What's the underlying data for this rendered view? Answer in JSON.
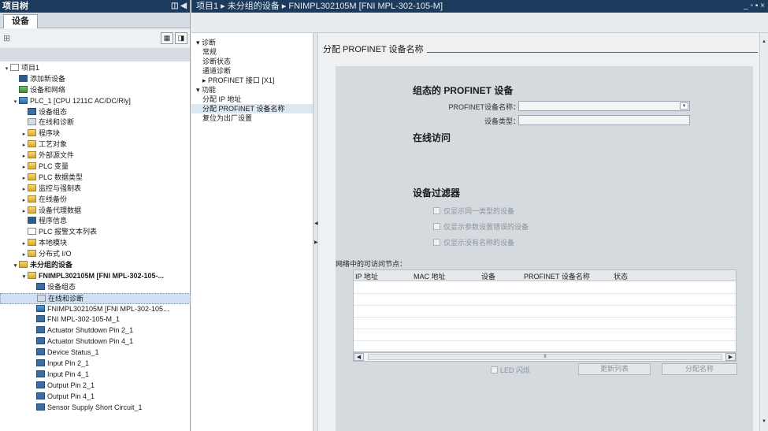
{
  "left": {
    "title": "项目树",
    "title_ctl": "◫ ◀",
    "tab": "设备",
    "toolbar_icon": "⊞",
    "tree": [
      {
        "label": "项目1",
        "level": 0,
        "arrow": "▾",
        "icon": "doc"
      },
      {
        "label": "添加新设备",
        "level": 1,
        "arrow": "",
        "icon": "blue"
      },
      {
        "label": "设备和网络",
        "level": 1,
        "arrow": "",
        "icon": "green"
      },
      {
        "label": "PLC_1 [CPU 1211C AC/DC/Rly]",
        "level": 1,
        "arrow": "▾",
        "icon": "plc"
      },
      {
        "label": "设备组态",
        "level": 2,
        "arrow": "",
        "icon": "chip"
      },
      {
        "label": "在线和诊断",
        "level": 2,
        "arrow": "",
        "icon": "gray"
      },
      {
        "label": "程序块",
        "level": 2,
        "arrow": "▸",
        "icon": "folder"
      },
      {
        "label": "工艺对象",
        "level": 2,
        "arrow": "▸",
        "icon": "folder"
      },
      {
        "label": "外部源文件",
        "level": 2,
        "arrow": "▸",
        "icon": "folder"
      },
      {
        "label": "PLC 变量",
        "level": 2,
        "arrow": "▸",
        "icon": "folder"
      },
      {
        "label": "PLC 数据类型",
        "level": 2,
        "arrow": "▸",
        "icon": "folder"
      },
      {
        "label": "监控与强制表",
        "level": 2,
        "arrow": "▸",
        "icon": "folder"
      },
      {
        "label": "在线备份",
        "level": 2,
        "arrow": "▸",
        "icon": "folder"
      },
      {
        "label": "设备代理数据",
        "level": 2,
        "arrow": "▸",
        "icon": "folder"
      },
      {
        "label": "程序信息",
        "level": 2,
        "arrow": "",
        "icon": "blue"
      },
      {
        "label": "PLC 报警文本列表",
        "level": 2,
        "arrow": "",
        "icon": "doc"
      },
      {
        "label": "本地模块",
        "level": 2,
        "arrow": "▸",
        "icon": "folder"
      },
      {
        "label": "分布式 I/O",
        "level": 2,
        "arrow": "▸",
        "icon": "folder"
      },
      {
        "label": "未分组的设备",
        "level": 1,
        "arrow": "▾",
        "icon": "folder",
        "bold": true
      },
      {
        "label": "FNIMPL302105M [FNI MPL-302-105-...",
        "level": 2,
        "arrow": "▾",
        "icon": "folder",
        "bold": true
      },
      {
        "label": "设备组态",
        "level": 3,
        "arrow": "",
        "icon": "chip"
      },
      {
        "label": "在线和诊断",
        "level": 3,
        "arrow": "",
        "icon": "gray",
        "selected": true
      },
      {
        "label": "FNIMPL302105M [FNI MPL-302-105...",
        "level": 3,
        "arrow": "",
        "icon": "plc"
      },
      {
        "label": "FNI MPL-302-105-M_1",
        "level": 3,
        "arrow": "",
        "icon": "chip"
      },
      {
        "label": "Actuator Shutdown Pin 2_1",
        "level": 3,
        "arrow": "",
        "icon": "chip"
      },
      {
        "label": "Actuator Shutdown Pin 4_1",
        "level": 3,
        "arrow": "",
        "icon": "chip"
      },
      {
        "label": "Device Status_1",
        "level": 3,
        "arrow": "",
        "icon": "chip"
      },
      {
        "label": "Input Pin 2_1",
        "level": 3,
        "arrow": "",
        "icon": "chip"
      },
      {
        "label": "Input Pin 4_1",
        "level": 3,
        "arrow": "",
        "icon": "chip"
      },
      {
        "label": "Output Pin 2_1",
        "level": 3,
        "arrow": "",
        "icon": "chip"
      },
      {
        "label": "Output Pin 4_1",
        "level": 3,
        "arrow": "",
        "icon": "chip"
      },
      {
        "label": "Sensor Supply Short Circuit_1",
        "level": 3,
        "arrow": "",
        "icon": "chip"
      }
    ]
  },
  "header": {
    "breadcrumb": "项目1 ▸ 未分组的设备 ▸ FNIMPL302105M [FNI MPL-302-105-M]",
    "window_controls": "_ ▫ ▪ ×"
  },
  "nav": [
    {
      "label": "▾ 诊断",
      "level": 0
    },
    {
      "label": "常规",
      "level": 1
    },
    {
      "label": "诊断状态",
      "level": 1
    },
    {
      "label": "通道诊断",
      "level": 1
    },
    {
      "label": "▸ PROFINET 接口 [X1]",
      "level": 1
    },
    {
      "label": "▾ 功能",
      "level": 0
    },
    {
      "label": "分配 IP 地址",
      "level": 1
    },
    {
      "label": "分配 PROFINET 设备名称",
      "level": 1,
      "selected": true
    },
    {
      "label": "复位为出厂设置",
      "level": 1
    }
  ],
  "main": {
    "section_title": "分配 PROFINET 设备名称",
    "configured_heading": "组态的 PROFINET 设备",
    "name_label": "PROFINET设备名称：",
    "name_value": "",
    "type_label": "设备类型：",
    "type_value": "",
    "online_heading": "在线访问",
    "filter_heading": "设备过滤器",
    "filters": [
      "仅显示同一类型的设备",
      "仅显示参数设置错误的设备",
      "仅显示没有名称的设备"
    ],
    "table_label": "网络中的可访问节点：",
    "columns": [
      "IP 地址",
      "MAC 地址",
      "设备",
      "PROFINET 设备名称",
      "状态"
    ],
    "scroll_thumb": "II",
    "led_label": "LED 闪烁",
    "refresh_button": "更新列表",
    "assign_button": "分配名称"
  }
}
